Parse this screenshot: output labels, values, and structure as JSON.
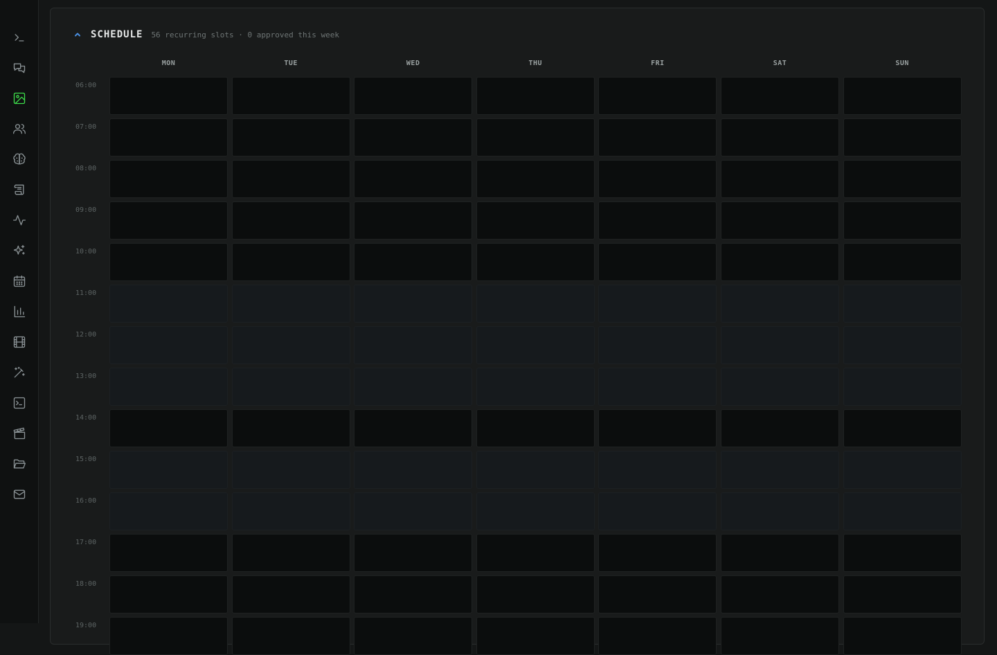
{
  "sidebar": {
    "items": [
      {
        "icon": "terminal-prompt-icon",
        "active": false
      },
      {
        "icon": "chat-bubbles-icon",
        "active": false
      },
      {
        "icon": "image-icon",
        "active": true
      },
      {
        "icon": "users-icon",
        "active": false
      },
      {
        "icon": "brain-icon",
        "active": false
      },
      {
        "icon": "scroll-icon",
        "active": false
      },
      {
        "icon": "activity-icon",
        "active": false
      },
      {
        "icon": "sparkles-icon",
        "active": false
      },
      {
        "icon": "calendar-icon",
        "active": false
      },
      {
        "icon": "bar-chart-icon",
        "active": false
      },
      {
        "icon": "film-icon",
        "active": false
      },
      {
        "icon": "magic-wand-icon",
        "active": false
      },
      {
        "icon": "terminal-window-icon",
        "active": false
      },
      {
        "icon": "clapperboard-icon",
        "active": false
      },
      {
        "icon": "folder-open-icon",
        "active": false
      },
      {
        "icon": "mail-icon",
        "active": false
      }
    ],
    "active_color": "#3ddc4a"
  },
  "schedule": {
    "title": "SCHEDULE",
    "summary": "56 recurring slots · 0 approved this week",
    "days": [
      "MON",
      "TUE",
      "WED",
      "THU",
      "FRI",
      "SAT",
      "SUN"
    ],
    "hours": [
      "06:00",
      "07:00",
      "08:00",
      "09:00",
      "10:00",
      "11:00",
      "12:00",
      "13:00",
      "14:00",
      "15:00",
      "16:00",
      "17:00",
      "18:00",
      "19:00"
    ],
    "shaded_hours": [
      "11:00",
      "12:00",
      "13:00",
      "15:00",
      "16:00"
    ]
  }
}
